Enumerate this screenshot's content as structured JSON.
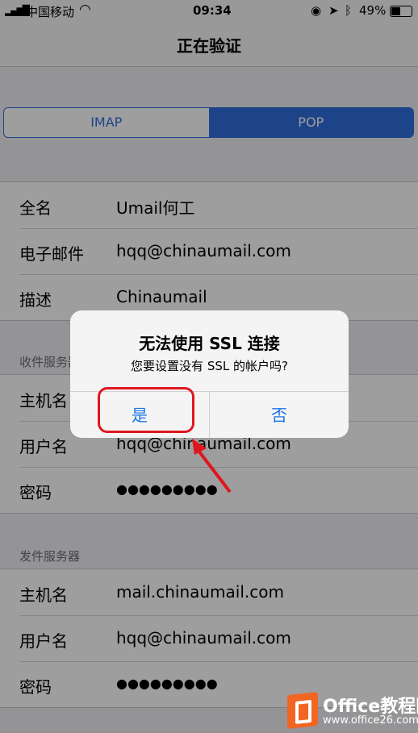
{
  "status_bar": {
    "carrier": "中国移动",
    "time": "09:34",
    "battery": "49%"
  },
  "nav": {
    "title": "正在验证"
  },
  "protocol": {
    "options": [
      "IMAP",
      "POP"
    ],
    "selected": "POP"
  },
  "account": {
    "name_label": "全名",
    "name_value": "Umail何工",
    "email_label": "电子邮件",
    "email_value": "hqq@chinaumail.com",
    "desc_label": "描述",
    "desc_value": "Chinaumail"
  },
  "incoming": {
    "header": "收件服务器",
    "host_label": "主机名",
    "user_label": "用户名",
    "user_value": "hqq@chinaumail.com",
    "pass_label": "密码",
    "pass_value": "●●●●●●●●●"
  },
  "outgoing": {
    "header": "发件服务器",
    "host_label": "主机名",
    "host_value": "mail.chinaumail.com",
    "user_label": "用户名",
    "user_value": "hqq@chinaumail.com",
    "pass_label": "密码",
    "pass_value": "●●●●●●●●●"
  },
  "alert": {
    "title": "无法使用 SSL 连接",
    "message": "您要设置没有 SSL 的帐户吗?",
    "yes": "是",
    "no": "否"
  },
  "watermark": {
    "title": "Office教程网",
    "url": "www.office26.com"
  },
  "colors": {
    "accent": "#2f6fdc",
    "highlight": "#e0161e"
  }
}
